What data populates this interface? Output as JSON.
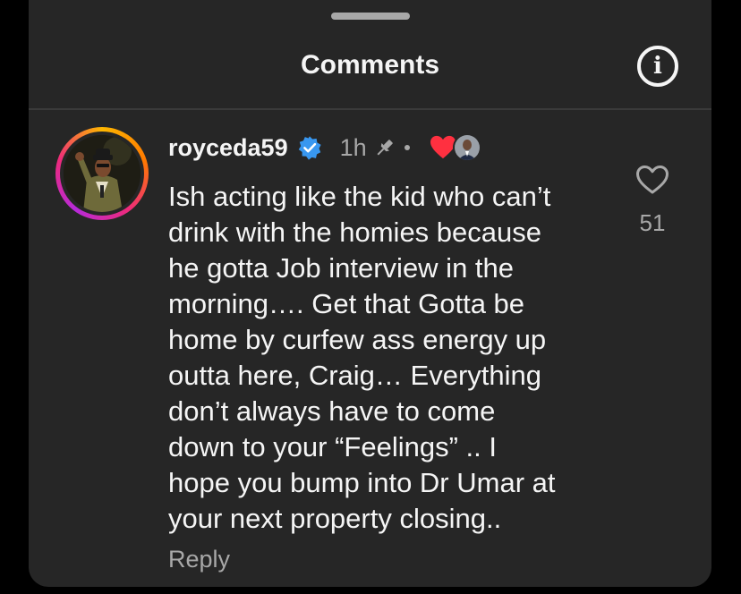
{
  "sheet": {
    "title": "Comments"
  },
  "comment": {
    "username": "royceda59",
    "verified": true,
    "time": "1h",
    "pinned": true,
    "liked_by_creator": true,
    "text_lines": [
      "Ish acting like the kid who can’t",
      "drink with the homies because",
      "he gotta Job interview in the",
      "morning…. Get that Gotta be",
      "home by curfew ass energy up",
      "outta here, Craig…  Everything",
      "don’t always have to come",
      "down to your “Feelings” .. I",
      "hope you bump into Dr Umar at",
      "your next property closing.."
    ],
    "reply_label": "Reply",
    "like_count": "51"
  },
  "icons": {
    "info": "info-icon",
    "verified": "verified-badge-icon",
    "pin": "pin-icon",
    "creator_heart": "heart-filled-icon",
    "like": "heart-outline-icon"
  },
  "colors": {
    "background": "#262626",
    "text": "#f5f5f5",
    "muted": "#a8a8a8",
    "verified_blue": "#3897f0",
    "heart_red": "#ff3040"
  }
}
